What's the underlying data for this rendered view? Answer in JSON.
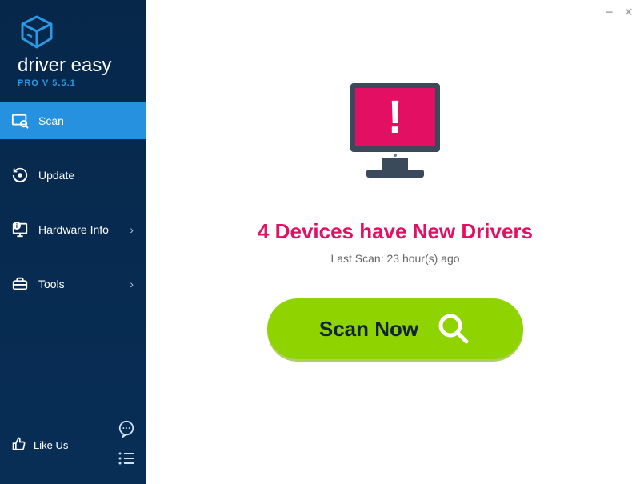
{
  "app": {
    "name": "driver easy",
    "version_label": "PRO V 5.5.1"
  },
  "sidebar": {
    "items": [
      {
        "label": "Scan",
        "icon": "scan-icon",
        "active": true,
        "has_chevron": false
      },
      {
        "label": "Update",
        "icon": "update-icon",
        "active": false,
        "has_chevron": false
      },
      {
        "label": "Hardware Info",
        "icon": "hardware-icon",
        "active": false,
        "has_chevron": true
      },
      {
        "label": "Tools",
        "icon": "tools-icon",
        "active": false,
        "has_chevron": true
      }
    ],
    "like_us_label": "Like Us"
  },
  "main": {
    "headline": "4 Devices have New Drivers",
    "last_scan_label": "Last Scan: 23 hour(s) ago",
    "scan_button_label": "Scan Now"
  },
  "colors": {
    "accent_pink": "#e30f63",
    "accent_green": "#8fd400",
    "sidebar_bg": "#06274a",
    "active_blue": "#2691de"
  },
  "window_controls": {
    "minimize": "−",
    "close": "×"
  }
}
